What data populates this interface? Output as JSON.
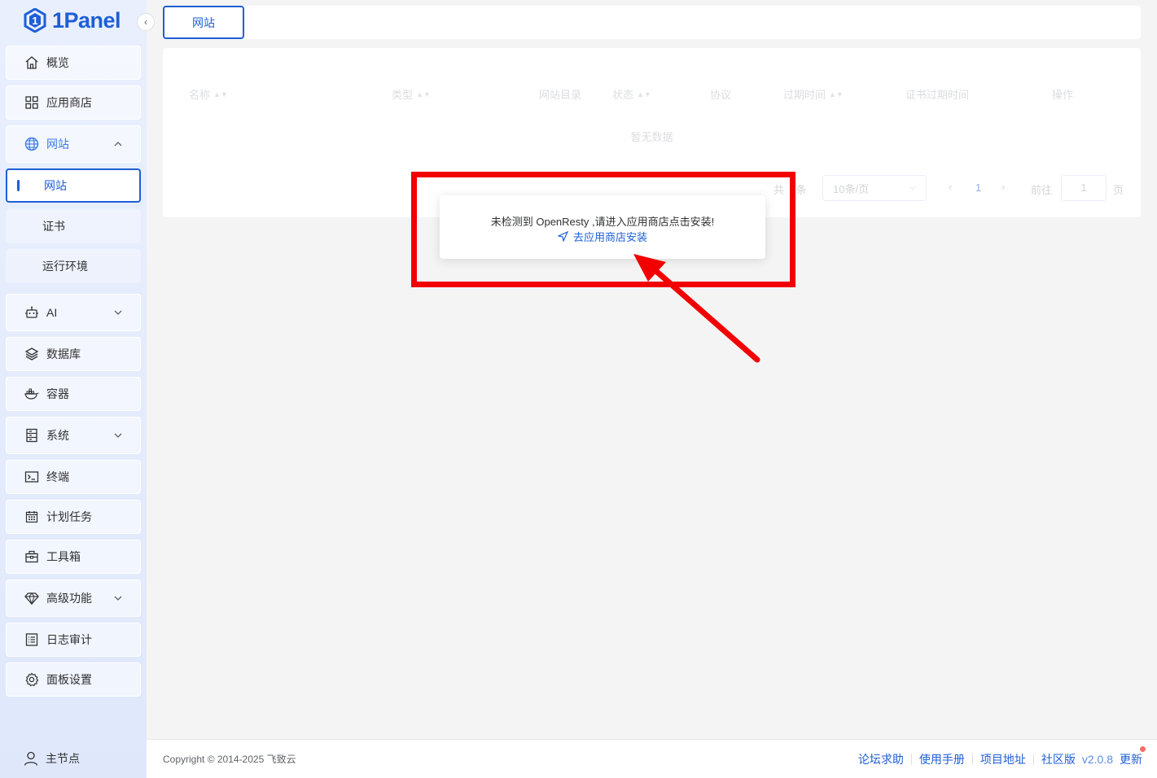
{
  "app": {
    "logo_text": "1Panel"
  },
  "sidebar": {
    "items": [
      {
        "label": "概览",
        "icon": "home-icon"
      },
      {
        "label": "应用商店",
        "icon": "grid-icon"
      },
      {
        "label": "网站",
        "icon": "globe-icon",
        "expanded": true
      },
      {
        "label": "AI",
        "icon": "robot-icon"
      },
      {
        "label": "数据库",
        "icon": "layers-icon"
      },
      {
        "label": "容器",
        "icon": "docker-icon"
      },
      {
        "label": "系统",
        "icon": "server-icon"
      },
      {
        "label": "终端",
        "icon": "terminal-icon"
      },
      {
        "label": "计划任务",
        "icon": "calendar-icon"
      },
      {
        "label": "工具箱",
        "icon": "toolbox-icon"
      },
      {
        "label": "高级功能",
        "icon": "diamond-icon"
      },
      {
        "label": "日志审计",
        "icon": "log-icon"
      },
      {
        "label": "面板设置",
        "icon": "gear-icon"
      }
    ],
    "website_sub": [
      "网站",
      "证书",
      "运行环境"
    ],
    "node_label": "主节点"
  },
  "header": {
    "active_tab": "网站"
  },
  "table": {
    "columns": [
      "名称",
      "类型",
      "网站目录",
      "状态",
      "协议",
      "过期时间",
      "证书过期时间",
      "操作"
    ],
    "empty_text": "暂无数据"
  },
  "pagination": {
    "total_prefix": "共",
    "total_suffix": "条",
    "page_size": "10条/页",
    "current_page": "1",
    "goto_label": "前往",
    "goto_value": "1",
    "page_label": "页"
  },
  "popup": {
    "message": "未检测到 OpenResty ,请进入应用商店点击安装!",
    "link": "去应用商店安装"
  },
  "footer": {
    "copyright": "Copyright © 2014-2025 飞致云",
    "links": [
      "论坛求助",
      "使用手册",
      "项目地址",
      "社区版"
    ],
    "version": "v2.0.8",
    "update": "更新"
  },
  "colors": {
    "primary": "#1f5fd6",
    "highlight": "#f20000",
    "badge": "#f56c6c"
  }
}
